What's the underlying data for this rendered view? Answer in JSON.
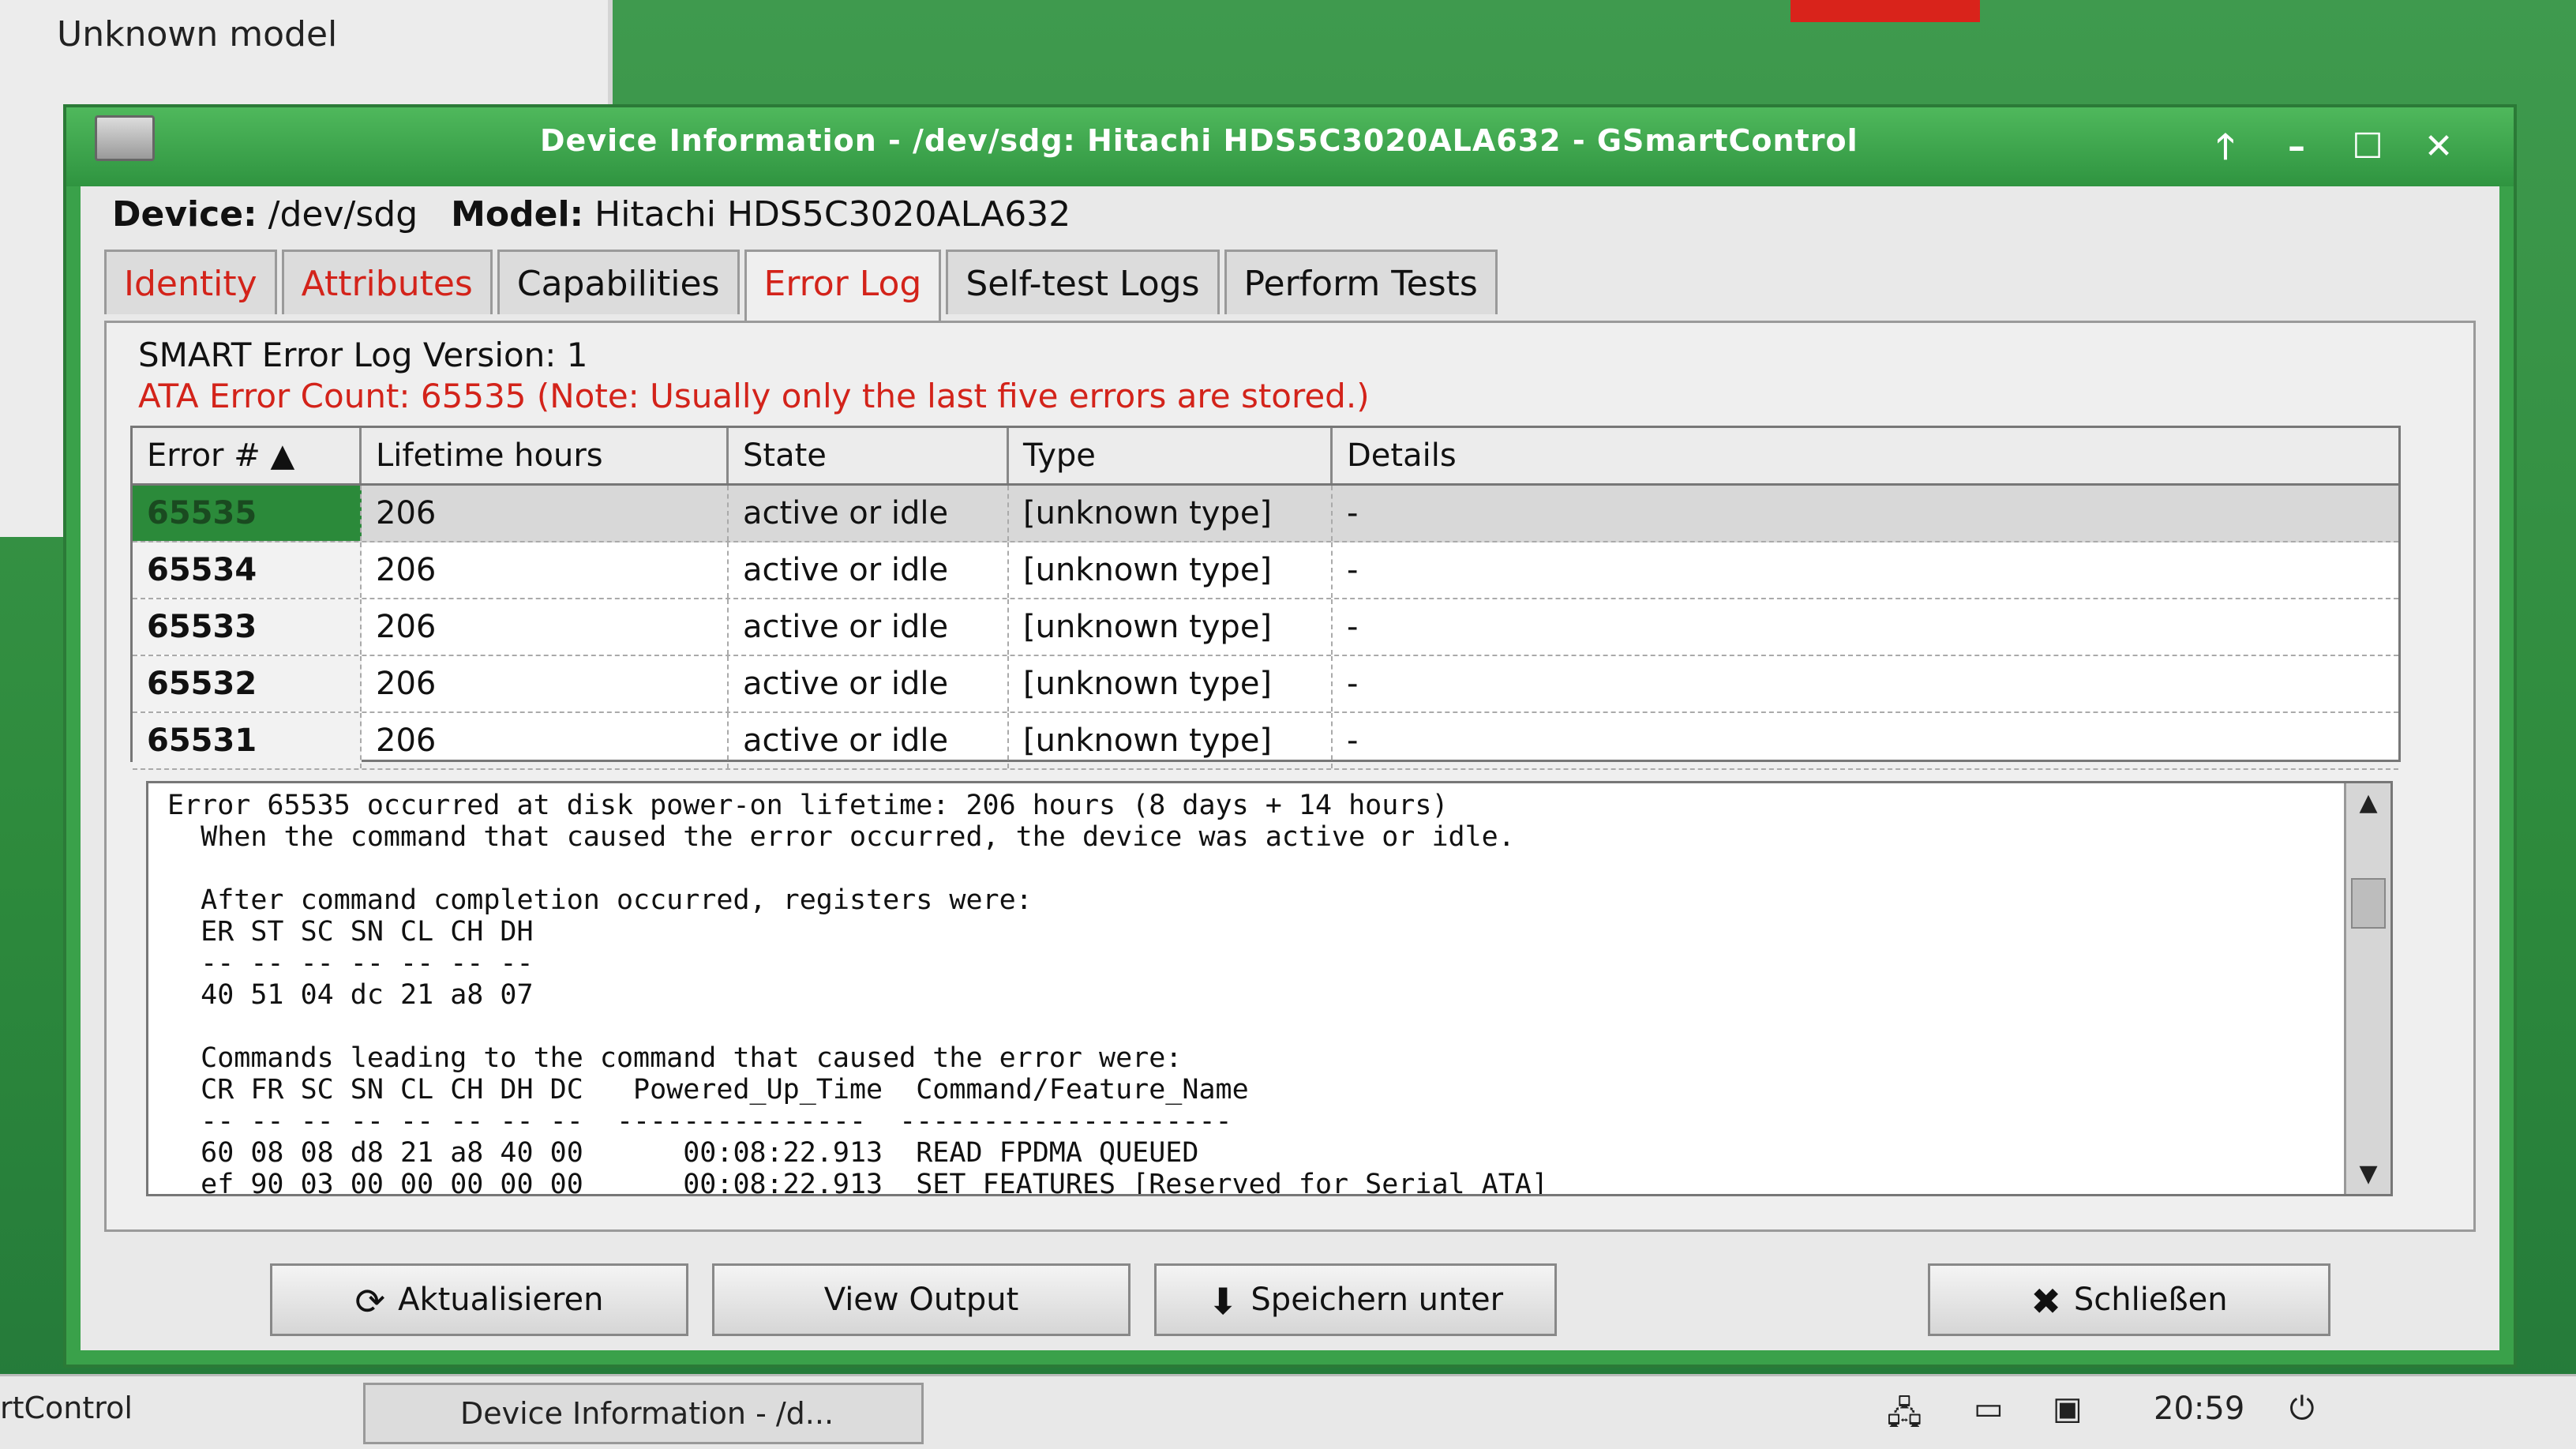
{
  "background_window": {
    "text": "Unknown model"
  },
  "window": {
    "title": "Device Information - /dev/sdg: Hitachi HDS5C3020ALA632 - GSmartControl",
    "controls": {
      "up": "🡑",
      "minimize": "–",
      "maximize": "☐",
      "close": "✕"
    }
  },
  "device": {
    "device_label": "Device:",
    "device_value": "/dev/sdg",
    "model_label": "Model:",
    "model_value": "Hitachi HDS5C3020ALA632"
  },
  "tabs": [
    {
      "label": "Identity"
    },
    {
      "label": "Attributes"
    },
    {
      "label": "Capabilities"
    },
    {
      "label": "Error Log"
    },
    {
      "label": "Self-test Logs"
    },
    {
      "label": "Perform Tests"
    }
  ],
  "error_log": {
    "version_text": "SMART Error Log Version: 1",
    "count_text": "ATA Error Count: 65535 (Note: Usually only the last five errors are stored.)",
    "columns": [
      "Error # ▲",
      "Lifetime hours",
      "State",
      "Type",
      "Details"
    ],
    "rows": [
      {
        "num": "65535",
        "hours": "206",
        "state": "active or idle",
        "type": "[unknown type]",
        "details": "-"
      },
      {
        "num": "65534",
        "hours": "206",
        "state": "active or idle",
        "type": "[unknown type]",
        "details": "-"
      },
      {
        "num": "65533",
        "hours": "206",
        "state": "active or idle",
        "type": "[unknown type]",
        "details": "-"
      },
      {
        "num": "65532",
        "hours": "206",
        "state": "active or idle",
        "type": "[unknown type]",
        "details": "-"
      },
      {
        "num": "65531",
        "hours": "206",
        "state": "active or idle",
        "type": "[unknown type]",
        "details": "-"
      }
    ],
    "details_text": "Error 65535 occurred at disk power-on lifetime: 206 hours (8 days + 14 hours)\n  When the command that caused the error occurred, the device was active or idle.\n\n  After command completion occurred, registers were:\n  ER ST SC SN CL CH DH\n  -- -- -- -- -- -- --\n  40 51 04 dc 21 a8 07\n\n  Commands leading to the command that caused the error were:\n  CR FR SC SN CL CH DH DC   Powered_Up_Time  Command/Feature_Name\n  -- -- -- -- -- -- -- --  ---------------  --------------------\n  60 08 08 d8 21 a8 40 00      00:08:22.913  READ FPDMA QUEUED\n  ef 90 03 00 00 00 00 00      00:08:22.913  SET FEATURES [Reserved for Serial ATA]"
  },
  "buttons": {
    "refresh": "Aktualisieren",
    "view_output": "View Output",
    "save_as": "Speichern unter",
    "close": "Schließen"
  },
  "taskbar": {
    "left_label": "rtControl",
    "task_label": "Device Information - /d...",
    "clock": "20:59"
  }
}
